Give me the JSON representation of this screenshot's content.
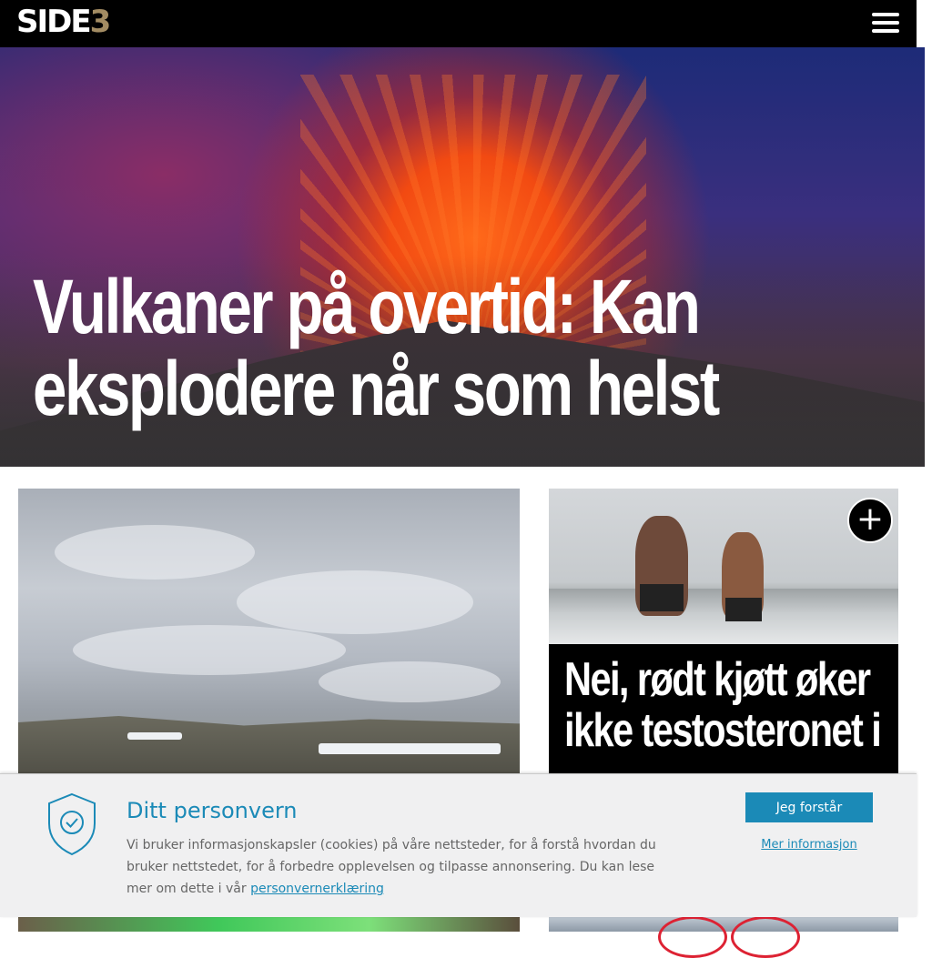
{
  "header": {
    "logo_main": "SIDE",
    "logo_number": "3",
    "menu_icon": "hamburger-icon"
  },
  "hero": {
    "title": "Vulkaner på overtid: Kan eksplodere når som helst"
  },
  "articles": {
    "right": {
      "title": "Nei, rødt kjøtt øker ikke testosteronet i",
      "action_icon": "plus-icon"
    }
  },
  "cookie_banner": {
    "icon": "shield-check-icon",
    "title": "Ditt personvern",
    "text": "Vi bruker informasjonskapsler (cookies) på våre nettsteder, for å forstå hvordan du bruker nettstedet, for å forbedre opplevelsen og tilpasse annonsering. Du kan lese mer om dette i vår ",
    "link_label": "personvernerklæring",
    "accept_label": "Jeg forstår",
    "more_label": "Mer informasjon"
  },
  "colors": {
    "brand_accent": "#a38c63",
    "link_blue": "#1b8ab7",
    "header_bg": "#000000"
  }
}
